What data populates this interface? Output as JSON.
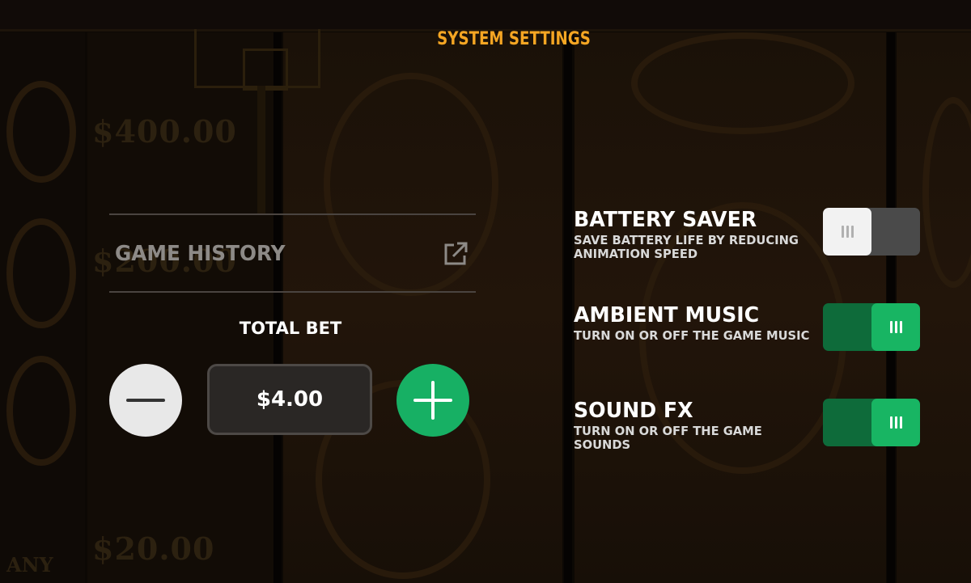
{
  "header": {
    "title": "SYSTEM SETTINGS"
  },
  "background": {
    "prizes": [
      "$400.00",
      "$200.00",
      "$20.00"
    ],
    "any_label": "ANY"
  },
  "left_panel": {
    "game_history_label": "GAME HISTORY",
    "game_history_icon": "external-link-icon",
    "total_bet_label": "TOTAL BET",
    "bet_value": "$4.00",
    "decrease_icon": "minus-icon",
    "increase_icon": "plus-icon"
  },
  "settings": [
    {
      "title": "BATTERY SAVER",
      "description": "SAVE BATTERY LIFE BY REDUCING ANIMATION SPEED",
      "enabled": false
    },
    {
      "title": "AMBIENT MUSIC",
      "description": "TURN ON OR OFF THE GAME MUSIC",
      "enabled": true
    },
    {
      "title": "SOUND FX",
      "description": "TURN ON OR OFF THE GAME SOUNDS",
      "enabled": true
    }
  ],
  "colors": {
    "title": "#f5a623",
    "toggle_on": "#18b563",
    "toggle_track_on": "#0e6b3a",
    "toggle_off_track": "#4a4a4a",
    "plus_button": "#17b064",
    "minus_button": "#e8e8e8"
  }
}
